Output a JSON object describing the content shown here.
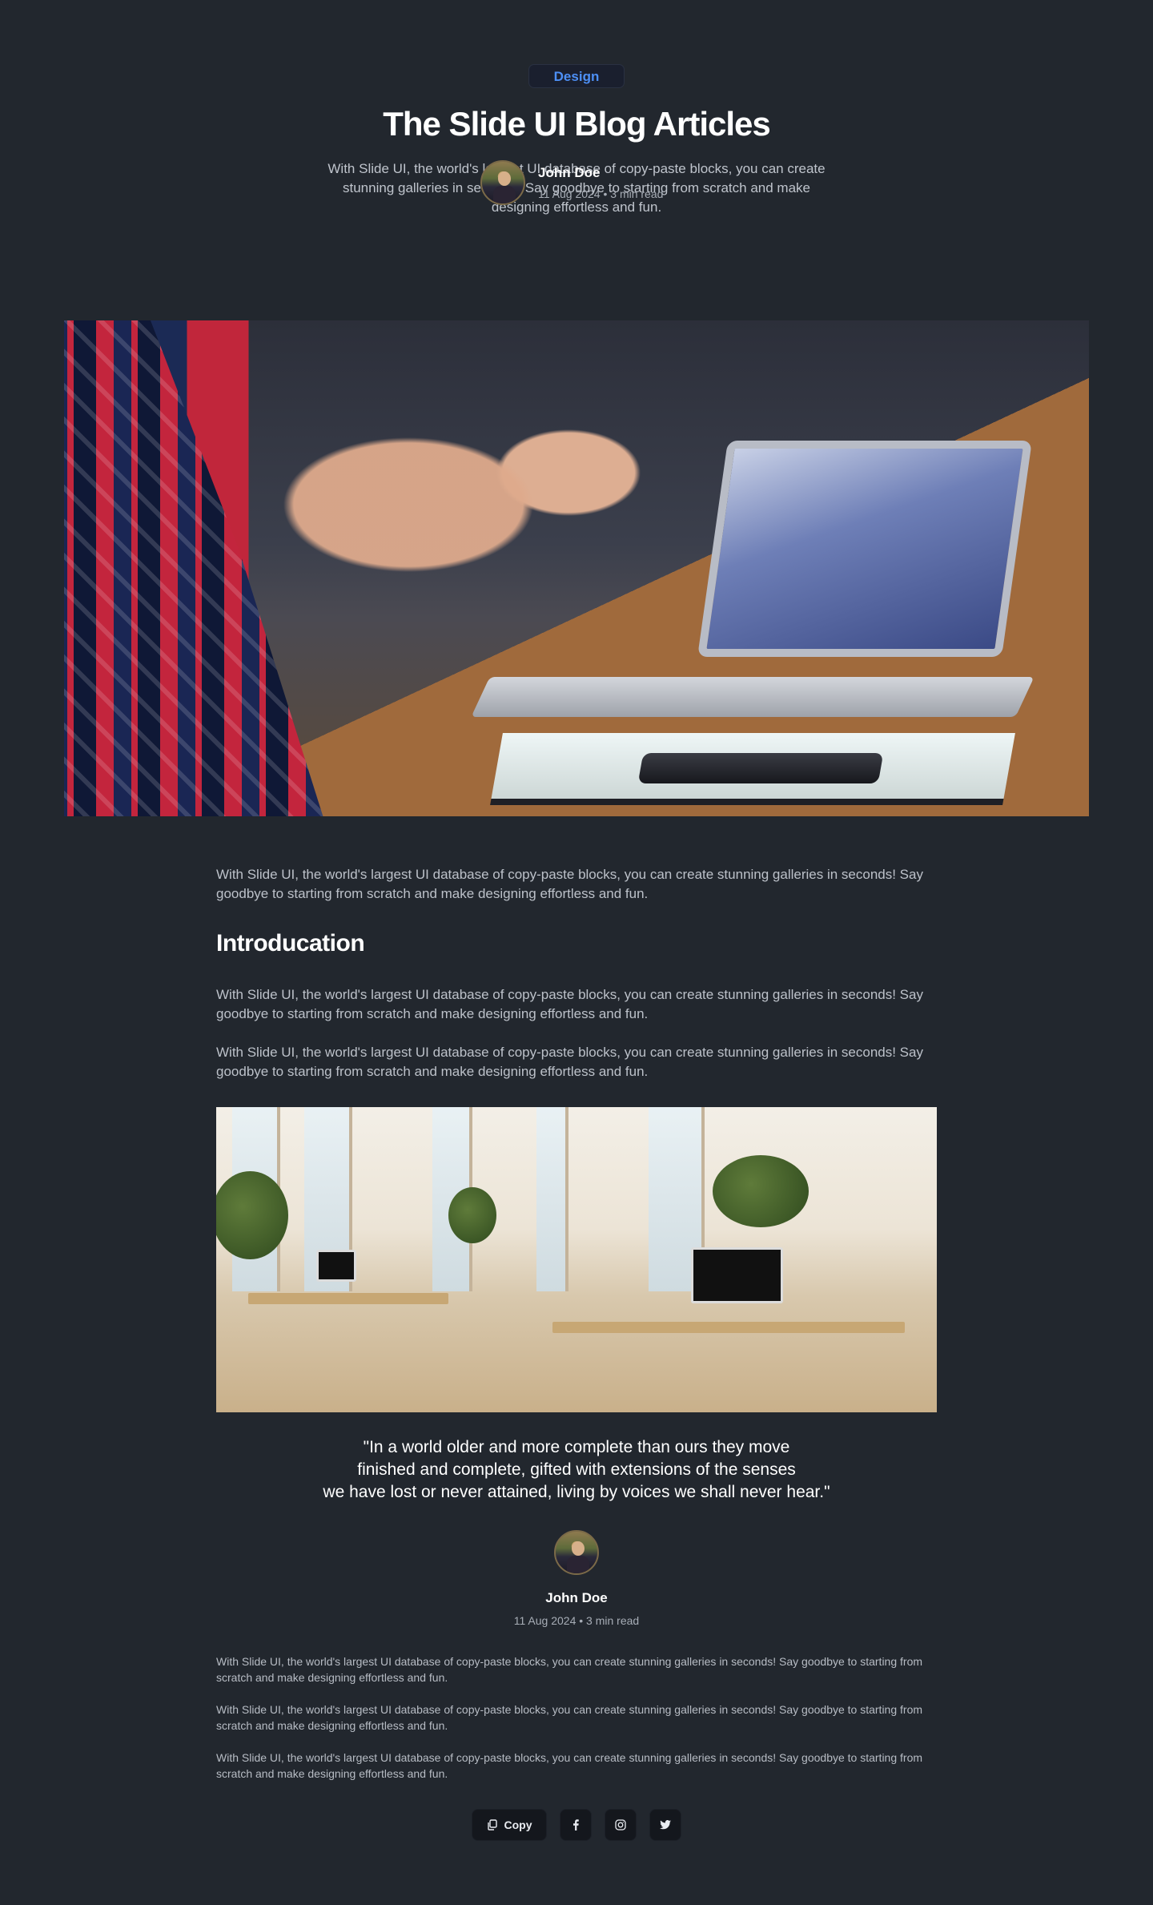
{
  "header": {
    "tag": "Design",
    "title": "The Slide UI Blog Articles",
    "subtitle": "With Slide UI, the world's largest UI database of copy-paste blocks, you can create stunning galleries in seconds! Say goodbye to starting from scratch and make designing effortless and fun.",
    "author": {
      "name": "John Doe",
      "meta": "11 Aug 2024 • 3 min read"
    }
  },
  "article": {
    "lead": "With Slide UI, the world's largest UI database of copy-paste blocks, you can create stunning galleries in seconds! Say goodbye to starting from scratch and make designing effortless and fun.",
    "heading": "Introducation",
    "paragraphs": [
      "With Slide UI, the world's largest UI database of copy-paste blocks, you can create stunning galleries in seconds! Say goodbye to starting from scratch and make designing effortless and fun.",
      "With Slide UI, the world's largest UI database of copy-paste blocks, you can create stunning galleries in seconds! Say goodbye to starting from scratch and make designing effortless and fun."
    ]
  },
  "quote": {
    "lines": [
      "\"In a world older and more complete than ours they move",
      "finished and complete, gifted with extensions of the senses",
      "we have lost or never attained, living by voices we shall never hear.\""
    ],
    "author": {
      "name": "John Doe",
      "meta": "11 Aug 2024 • 3 min read"
    }
  },
  "footer_paragraphs": [
    "With Slide UI, the world's largest UI database of copy-paste blocks, you can create stunning galleries in seconds! Say goodbye to starting from scratch and make designing effortless and fun.",
    "With Slide UI, the world's largest UI database of copy-paste blocks, you can create stunning galleries in seconds! Say goodbye to starting from scratch and make designing effortless and fun.",
    "With Slide UI, the world's largest UI database of copy-paste blocks, you can create stunning galleries in seconds! Say goodbye to starting from scratch and make designing effortless and fun."
  ],
  "share": {
    "copy_label": "Copy",
    "icons": [
      "copy-icon",
      "facebook-icon",
      "instagram-icon",
      "twitter-icon"
    ]
  },
  "colors": {
    "background": "#22272e",
    "accent": "#4d8ff5",
    "button_bg": "#14171d"
  }
}
